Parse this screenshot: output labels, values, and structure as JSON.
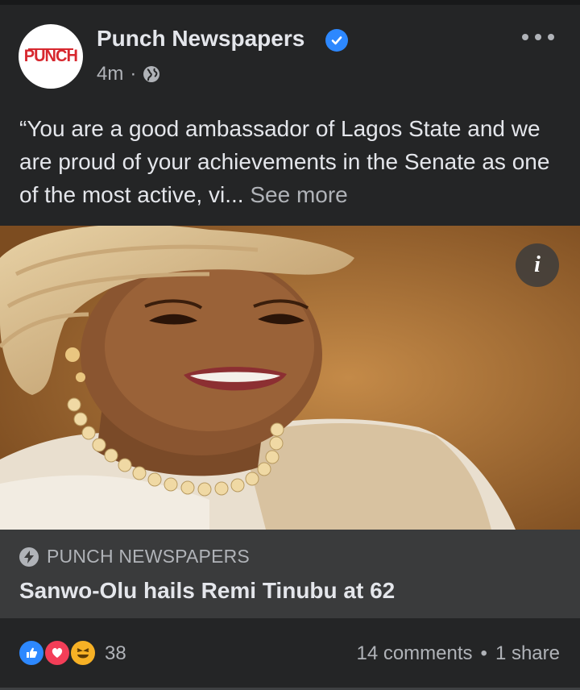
{
  "post": {
    "page_name": "Punch Newspapers",
    "verified": true,
    "logo_text": "PUNCH",
    "time": "4m",
    "separator": "·",
    "audience_icon": "globe-icon",
    "text": "“You are a good ambassador of Lagos State and we are proud of your achievements in the Senate as one of the most active, vi...",
    "see_more": "See more"
  },
  "photo": {
    "description_icon": "info-icon",
    "info_label": "i"
  },
  "link_card": {
    "source": "PUNCH NEWSPAPERS",
    "headline": "Sanwo-Olu hails Remi Tinubu at 62"
  },
  "footer": {
    "reaction_icons": [
      "like-icon",
      "love-icon",
      "haha-icon"
    ],
    "reaction_count": "38",
    "comments": "14 comments",
    "bullet": "•",
    "shares": "1 share"
  },
  "colors": {
    "background": "#242526",
    "card": "#3a3b3c",
    "text": "#e4e6eb",
    "secondary_text": "#b0b3b8",
    "verified_blue": "#2d88ff",
    "brand_red": "#d7282f"
  }
}
